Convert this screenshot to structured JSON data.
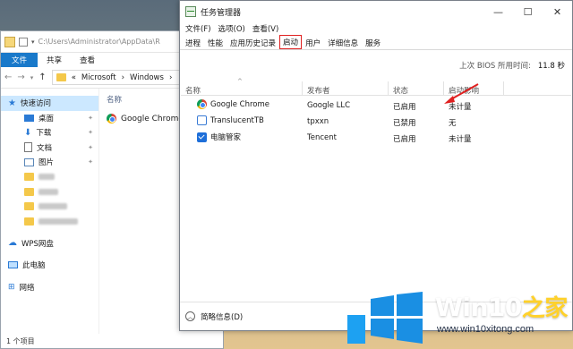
{
  "explorer": {
    "path_tiny": "C:\\Users\\Administrator\\AppData\\R",
    "ribbon": {
      "file": "文件",
      "share": "共享",
      "view": "查看"
    },
    "address": {
      "parts": [
        "«",
        "Microsoft",
        "›",
        "Windows",
        "›"
      ]
    },
    "nav": {
      "quick_access": "快速访问",
      "desktop": "桌面",
      "downloads": "下载",
      "documents": "文档",
      "pictures": "图片",
      "wps": "WPS网盘",
      "this_pc": "此电脑",
      "network": "网络"
    },
    "list": {
      "column": "名称",
      "item": "Google Chrome"
    },
    "status": "1 个项目"
  },
  "taskmgr": {
    "title": "任务管理器",
    "menu": [
      "文件(F)",
      "选项(O)",
      "查看(V)"
    ],
    "tabs": [
      "进程",
      "性能",
      "应用历史记录",
      "启动",
      "用户",
      "详细信息",
      "服务"
    ],
    "active_tab": "启动",
    "bios_label": "上次 BIOS 所用时间:",
    "bios_value": "11.8 秒",
    "columns": {
      "name": "名称",
      "publisher": "发布者",
      "status": "状态",
      "impact": "启动影响"
    },
    "rows": [
      {
        "name": "Google Chrome",
        "publisher": "Google LLC",
        "status": "已启用",
        "impact": "未计量",
        "icon": "chrome-icon"
      },
      {
        "name": "TranslucentTB",
        "publisher": "tpxxn",
        "status": "已禁用",
        "impact": "无",
        "icon": "translucenttb-icon"
      },
      {
        "name": "电脑管家",
        "publisher": "Tencent",
        "status": "已启用",
        "impact": "未计量",
        "icon": "pc-manager-icon"
      }
    ],
    "footer": "简略信息(D)"
  },
  "watermark": {
    "title": "Win10",
    "title_zh": "之家",
    "url": "www.win10xitong.com"
  },
  "colors": {
    "accent": "#1979ca",
    "highlight": "#e02020",
    "brand_yellow": "#ffd12a"
  }
}
